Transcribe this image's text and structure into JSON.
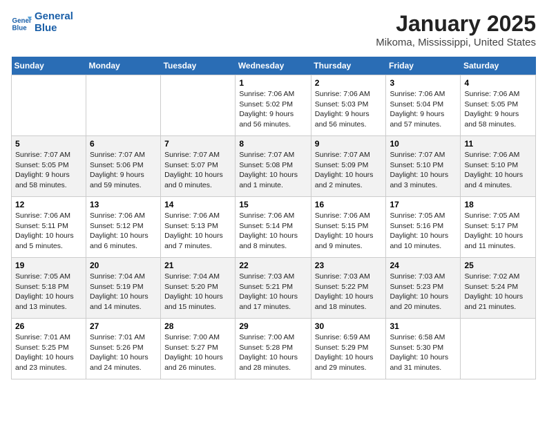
{
  "header": {
    "logo_line1": "General",
    "logo_line2": "Blue",
    "title": "January 2025",
    "subtitle": "Mikoma, Mississippi, United States"
  },
  "weekdays": [
    "Sunday",
    "Monday",
    "Tuesday",
    "Wednesday",
    "Thursday",
    "Friday",
    "Saturday"
  ],
  "weeks": [
    [
      {
        "day": "",
        "info": ""
      },
      {
        "day": "",
        "info": ""
      },
      {
        "day": "",
        "info": ""
      },
      {
        "day": "1",
        "info": "Sunrise: 7:06 AM\nSunset: 5:02 PM\nDaylight: 9 hours\nand 56 minutes."
      },
      {
        "day": "2",
        "info": "Sunrise: 7:06 AM\nSunset: 5:03 PM\nDaylight: 9 hours\nand 56 minutes."
      },
      {
        "day": "3",
        "info": "Sunrise: 7:06 AM\nSunset: 5:04 PM\nDaylight: 9 hours\nand 57 minutes."
      },
      {
        "day": "4",
        "info": "Sunrise: 7:06 AM\nSunset: 5:05 PM\nDaylight: 9 hours\nand 58 minutes."
      }
    ],
    [
      {
        "day": "5",
        "info": "Sunrise: 7:07 AM\nSunset: 5:05 PM\nDaylight: 9 hours\nand 58 minutes."
      },
      {
        "day": "6",
        "info": "Sunrise: 7:07 AM\nSunset: 5:06 PM\nDaylight: 9 hours\nand 59 minutes."
      },
      {
        "day": "7",
        "info": "Sunrise: 7:07 AM\nSunset: 5:07 PM\nDaylight: 10 hours\nand 0 minutes."
      },
      {
        "day": "8",
        "info": "Sunrise: 7:07 AM\nSunset: 5:08 PM\nDaylight: 10 hours\nand 1 minute."
      },
      {
        "day": "9",
        "info": "Sunrise: 7:07 AM\nSunset: 5:09 PM\nDaylight: 10 hours\nand 2 minutes."
      },
      {
        "day": "10",
        "info": "Sunrise: 7:07 AM\nSunset: 5:10 PM\nDaylight: 10 hours\nand 3 minutes."
      },
      {
        "day": "11",
        "info": "Sunrise: 7:06 AM\nSunset: 5:10 PM\nDaylight: 10 hours\nand 4 minutes."
      }
    ],
    [
      {
        "day": "12",
        "info": "Sunrise: 7:06 AM\nSunset: 5:11 PM\nDaylight: 10 hours\nand 5 minutes."
      },
      {
        "day": "13",
        "info": "Sunrise: 7:06 AM\nSunset: 5:12 PM\nDaylight: 10 hours\nand 6 minutes."
      },
      {
        "day": "14",
        "info": "Sunrise: 7:06 AM\nSunset: 5:13 PM\nDaylight: 10 hours\nand 7 minutes."
      },
      {
        "day": "15",
        "info": "Sunrise: 7:06 AM\nSunset: 5:14 PM\nDaylight: 10 hours\nand 8 minutes."
      },
      {
        "day": "16",
        "info": "Sunrise: 7:06 AM\nSunset: 5:15 PM\nDaylight: 10 hours\nand 9 minutes."
      },
      {
        "day": "17",
        "info": "Sunrise: 7:05 AM\nSunset: 5:16 PM\nDaylight: 10 hours\nand 10 minutes."
      },
      {
        "day": "18",
        "info": "Sunrise: 7:05 AM\nSunset: 5:17 PM\nDaylight: 10 hours\nand 11 minutes."
      }
    ],
    [
      {
        "day": "19",
        "info": "Sunrise: 7:05 AM\nSunset: 5:18 PM\nDaylight: 10 hours\nand 13 minutes."
      },
      {
        "day": "20",
        "info": "Sunrise: 7:04 AM\nSunset: 5:19 PM\nDaylight: 10 hours\nand 14 minutes."
      },
      {
        "day": "21",
        "info": "Sunrise: 7:04 AM\nSunset: 5:20 PM\nDaylight: 10 hours\nand 15 minutes."
      },
      {
        "day": "22",
        "info": "Sunrise: 7:03 AM\nSunset: 5:21 PM\nDaylight: 10 hours\nand 17 minutes."
      },
      {
        "day": "23",
        "info": "Sunrise: 7:03 AM\nSunset: 5:22 PM\nDaylight: 10 hours\nand 18 minutes."
      },
      {
        "day": "24",
        "info": "Sunrise: 7:03 AM\nSunset: 5:23 PM\nDaylight: 10 hours\nand 20 minutes."
      },
      {
        "day": "25",
        "info": "Sunrise: 7:02 AM\nSunset: 5:24 PM\nDaylight: 10 hours\nand 21 minutes."
      }
    ],
    [
      {
        "day": "26",
        "info": "Sunrise: 7:01 AM\nSunset: 5:25 PM\nDaylight: 10 hours\nand 23 minutes."
      },
      {
        "day": "27",
        "info": "Sunrise: 7:01 AM\nSunset: 5:26 PM\nDaylight: 10 hours\nand 24 minutes."
      },
      {
        "day": "28",
        "info": "Sunrise: 7:00 AM\nSunset: 5:27 PM\nDaylight: 10 hours\nand 26 minutes."
      },
      {
        "day": "29",
        "info": "Sunrise: 7:00 AM\nSunset: 5:28 PM\nDaylight: 10 hours\nand 28 minutes."
      },
      {
        "day": "30",
        "info": "Sunrise: 6:59 AM\nSunset: 5:29 PM\nDaylight: 10 hours\nand 29 minutes."
      },
      {
        "day": "31",
        "info": "Sunrise: 6:58 AM\nSunset: 5:30 PM\nDaylight: 10 hours\nand 31 minutes."
      },
      {
        "day": "",
        "info": ""
      }
    ]
  ]
}
